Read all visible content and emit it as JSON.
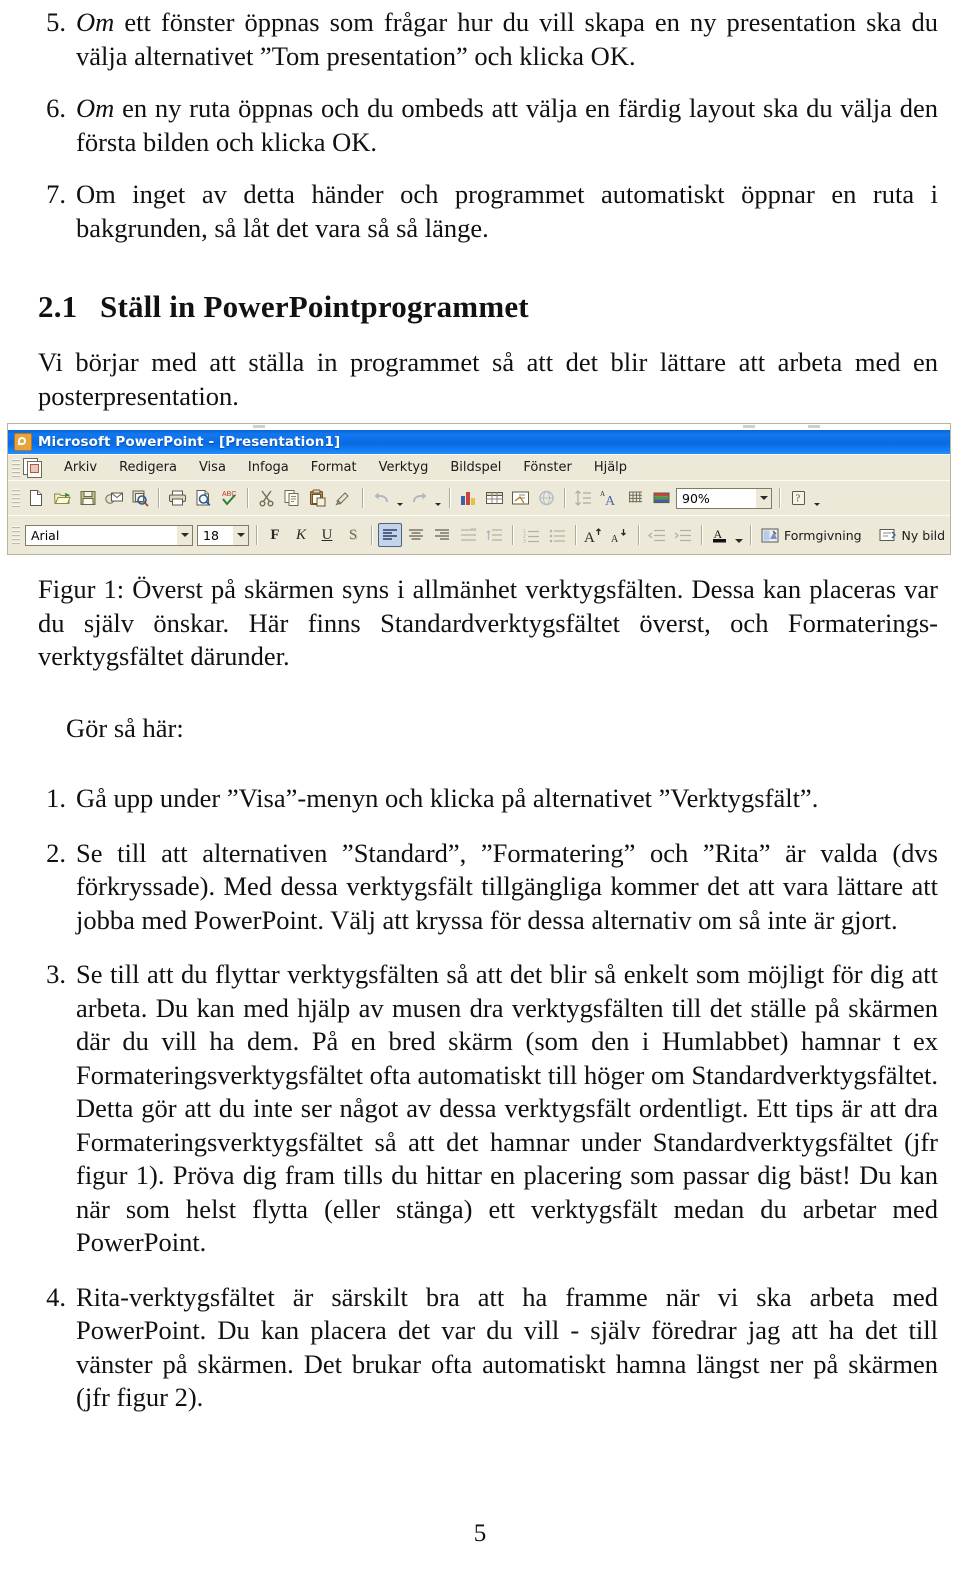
{
  "document": {
    "page_number": "5",
    "list_items_top": [
      {
        "number": "5.",
        "italic_lead": "Om",
        "text": " ett fönster öppnas som frågar hur du vill skapa en ny presentation ska du välja alternativet ”Tom presentation” och klicka OK."
      },
      {
        "number": "6.",
        "italic_lead": "Om",
        "text": " en ny ruta öppnas och du ombeds att välja en färdig layout ska du välja den första bilden och klicka OK."
      },
      {
        "number": "7.",
        "italic_lead": "",
        "text": "Om inget av detta händer och programmet automatiskt öppnar en ruta i bakgrunden, så låt det vara så så länge."
      }
    ],
    "section": {
      "number": "2.1",
      "title": "Ställ in PowerPointprogrammet",
      "intro": "Vi börjar med att ställa in programmet så att det blir lättare att arbeta med en posterpresentation."
    },
    "figure_caption": "Figur 1: Överst på skärmen syns i allmänhet verktygsfälten. Dessa kan placeras var du själv önskar. Här finns Standardverktygsfältet överst, och Formaterings-verktygsfältet därunder.",
    "gor_sa_har": "Gör så här:",
    "list_items_bottom": [
      {
        "number": "1.",
        "text": "Gå upp under ”Visa”-menyn och klicka på alternativet ”Verktygsfält”."
      },
      {
        "number": "2.",
        "text": "Se till att alternativen ”Standard”, ”Formatering” och ”Rita” är valda (dvs förkryssade). Med dessa verktygsfält tillgängliga kommer det att vara lättare att jobba med PowerPoint. Välj att kryssa för dessa alternativ om så inte är gjort."
      },
      {
        "number": "3.",
        "text": "Se till att du flyttar verktygsfälten så att det blir så enkelt som möjligt för dig att arbeta. Du kan med hjälp av musen dra verktygsfälten till det ställe på skärmen där du vill ha dem. På en bred skärm (som den i Humlabbet) hamnar t ex Formateringsverktygsfältet ofta automatiskt till höger om Standardverktygsfältet. Detta gör att du inte ser något av dessa verktygsfält ordentligt. Ett tips är att dra Formateringsverktygsfältet så att det hamnar under Standardverktygsfältet (jfr figur 1). Pröva dig fram tills du hittar en placering som passar dig bäst! Du kan när som helst flytta (eller stänga) ett verktygsfält medan du arbetar med PowerPoint."
      },
      {
        "number": "4.",
        "text": "Rita-verktygsfältet är särskilt bra att ha framme när vi ska arbeta med PowerPoint. Du kan placera det var du vill - själv föredrar jag att ha det till vänster på skärmen. Det brukar ofta automatiskt hamna längst ner på skärmen (jfr figur 2)."
      }
    ]
  },
  "figure": {
    "window_title": "Microsoft PowerPoint - [Presentation1]",
    "titlebar_color": "#0a6ae0",
    "chrome_color": "#ece9d8",
    "menu_items": [
      {
        "label": "Arkiv",
        "accel": "A"
      },
      {
        "label": "Redigera",
        "accel": "R"
      },
      {
        "label": "Visa",
        "accel": "V"
      },
      {
        "label": "Infoga",
        "accel": "I"
      },
      {
        "label": "Format",
        "accel": "t"
      },
      {
        "label": "Verktyg",
        "accel": "y"
      },
      {
        "label": "Bildspel",
        "accel": "B"
      },
      {
        "label": "Fönster",
        "accel": "ö"
      },
      {
        "label": "Hjälp",
        "accel": "H"
      }
    ],
    "standard_toolbar": {
      "icons": [
        "new-document-icon",
        "open-folder-icon",
        "save-disk-icon",
        "email-icon",
        "search-document-icon",
        "print-icon",
        "print-preview-icon",
        "spellcheck-icon",
        "cut-scissors-icon",
        "copy-icon",
        "paste-icon",
        "format-painter-icon",
        "undo-icon",
        "redo-icon",
        "insert-chart-icon",
        "insert-table-icon",
        "insert-slide-icon",
        "hyperlink-icon",
        "line-spacing-icon",
        "expand-all-icon",
        "show-grid-icon",
        "color-scheme-icon"
      ],
      "zoom_value": "90%",
      "help_label": "help-icon"
    },
    "formatting_toolbar": {
      "font_name": "Arial",
      "font_size": "18",
      "bold_label": "F",
      "italic_label": "K",
      "underline_label": "U",
      "shadow_label": "S",
      "align_icons": [
        "align-left-icon",
        "align-center-icon",
        "align-right-icon",
        "line-spacing-icon",
        "paragraph-spacing-icon"
      ],
      "list_icons": [
        "numbered-list-icon",
        "bulleted-list-icon"
      ],
      "size_icons": [
        "increase-font-size-icon",
        "decrease-font-size-icon"
      ],
      "indent_icons": [
        "promote-icon",
        "demote-icon"
      ],
      "font_color_icon": "font-color-icon",
      "design_label": "Formgivning",
      "design_accel": "F",
      "new_slide_label": "Ny bild",
      "new_slide_accel": "N"
    }
  }
}
